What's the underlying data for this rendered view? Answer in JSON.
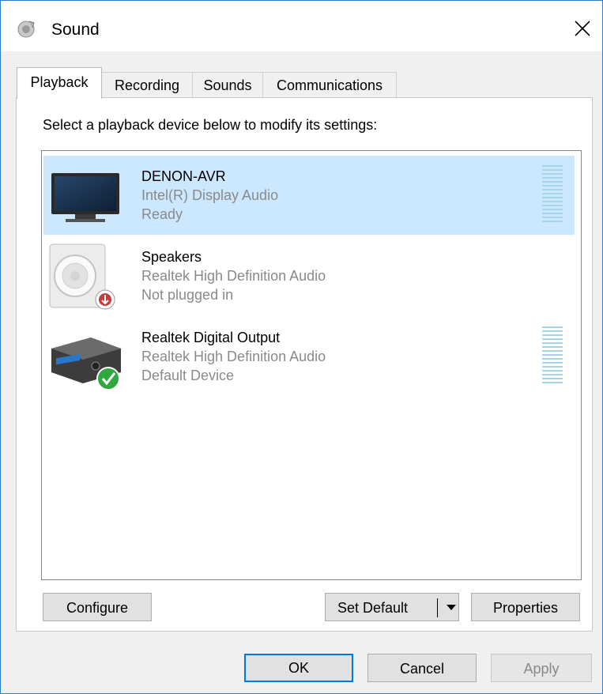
{
  "window": {
    "title": "Sound"
  },
  "tabs": [
    {
      "label": "Playback",
      "active": true
    },
    {
      "label": "Recording",
      "active": false
    },
    {
      "label": "Sounds",
      "active": false
    },
    {
      "label": "Communications",
      "active": false
    }
  ],
  "playback": {
    "prompt": "Select a playback device below to modify its settings:",
    "devices": [
      {
        "name": "DENON-AVR",
        "description": "Intel(R) Display Audio",
        "status": "Ready",
        "icon": "monitor-icon",
        "selected": true,
        "level_meter": true
      },
      {
        "name": "Speakers",
        "description": "Realtek High Definition Audio",
        "status": "Not plugged in",
        "icon": "speaker-icon",
        "badge": "unplugged-badge-icon",
        "selected": false,
        "level_meter": false
      },
      {
        "name": "Realtek Digital Output",
        "description": "Realtek High Definition Audio",
        "status": "Default Device",
        "icon": "receiver-icon",
        "badge": "default-check-icon",
        "selected": false,
        "level_meter": true
      }
    ],
    "buttons": {
      "configure": "Configure",
      "set_default": "Set Default",
      "properties": "Properties"
    }
  },
  "footer": {
    "ok": "OK",
    "cancel": "Cancel",
    "apply": "Apply",
    "apply_disabled": true
  },
  "colors": {
    "selection": "#cce8ff",
    "window_border": "#2b7fd1",
    "focus": "#0078d7",
    "meter": "#a8d4e8"
  }
}
